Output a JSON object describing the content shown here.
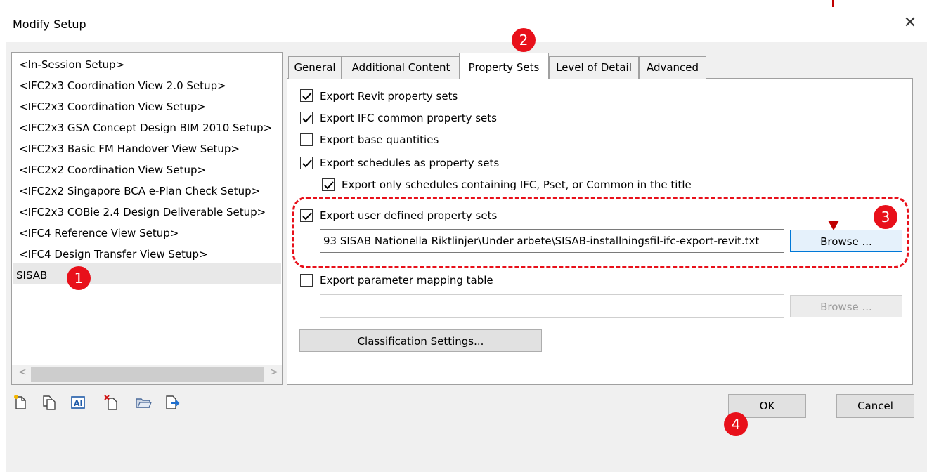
{
  "window": {
    "title": "Modify Setup",
    "close_glyph": "✕"
  },
  "setups": [
    "<In-Session Setup>",
    "<IFC2x3 Coordination View 2.0 Setup>",
    "<IFC2x3 Coordination View Setup>",
    "<IFC2x3 GSA Concept Design BIM 2010 Setup>",
    "<IFC2x3 Basic FM Handover View Setup>",
    "<IFC2x2 Coordination View Setup>",
    "<IFC2x2 Singapore BCA e-Plan Check Setup>",
    "<IFC2x3 COBie 2.4 Design Deliverable Setup>",
    "<IFC4 Reference View Setup>",
    "<IFC4 Design Transfer View Setup>",
    "SISAB"
  ],
  "selected_setup": "SISAB",
  "scroll_arrows": {
    "left": "<",
    "right": ">"
  },
  "tabs": [
    "General",
    "Additional Content",
    "Property Sets",
    "Level of Detail",
    "Advanced"
  ],
  "active_tab": "Property Sets",
  "options": {
    "revit_psets": {
      "label": "Export Revit property sets",
      "checked": true
    },
    "ifc_common_psets": {
      "label": "Export IFC common property sets",
      "checked": true
    },
    "base_quantities": {
      "label": "Export base quantities",
      "checked": false
    },
    "schedules_psets": {
      "label": "Export schedules as property sets",
      "checked": true
    },
    "schedules_filter": {
      "label": "Export only schedules containing IFC, Pset, or Common in the title",
      "checked": true
    },
    "user_defined_psets": {
      "label": "Export user defined property sets",
      "checked": true
    },
    "param_mapping": {
      "label": "Export parameter mapping table",
      "checked": false
    }
  },
  "user_defined_path": "93 SISAB Nationella Riktlinjer\\Under arbete\\SISAB-installningsfil-ifc-export-revit.txt",
  "param_mapping_path": "",
  "buttons": {
    "browse_user_defined": "Browse ...",
    "browse_param_mapping": "Browse ...",
    "classification": "Classification Settings...",
    "ok": "OK",
    "cancel": "Cancel"
  },
  "toolbar_icons": [
    "new-setup-icon",
    "duplicate-setup-icon",
    "rename-setup-icon",
    "delete-setup-icon",
    "import-setup-icon",
    "export-setup-icon"
  ],
  "annotations": [
    "1",
    "2",
    "3",
    "4"
  ],
  "colors": {
    "annotation_red": "#e8101a",
    "arrow": "#c00000",
    "focus_blue": "#0078d7"
  }
}
